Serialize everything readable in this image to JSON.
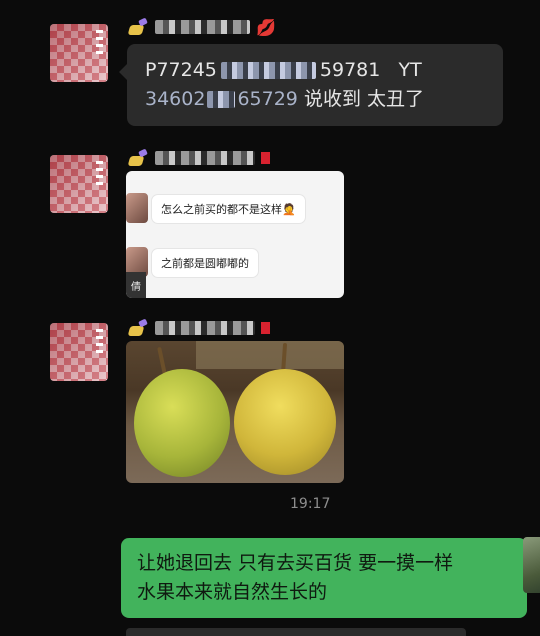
{
  "colors": {
    "background": "#0b0b0b",
    "incoming_bubble": "#2b2b2b",
    "outgoing_bubble": "#42b35c",
    "timestamp": "#8e8e8e"
  },
  "messages": [
    {
      "type": "text",
      "id_prefix": "P77245",
      "id_suffix": "59781",
      "carrier": "YT",
      "id2_prefix": "34602",
      "id2_suffix": "65729",
      "tail": "说收到 太丑了"
    },
    {
      "type": "screenshot",
      "lines": [
        "怎么之前买的都不是这样🤦",
        "之前都是圆嘟嘟的"
      ],
      "tab_char": "倩"
    },
    {
      "type": "image",
      "subject": "two yellow-green pears"
    }
  ],
  "timestamp": "19:17",
  "outgoing": {
    "line1": "让她退回去 只有去买百货 要一摸一样",
    "line2": "水果本来就自然生长的"
  },
  "icons": {
    "name_badge": "nail-polish-icon",
    "lips": "lips-icon"
  }
}
